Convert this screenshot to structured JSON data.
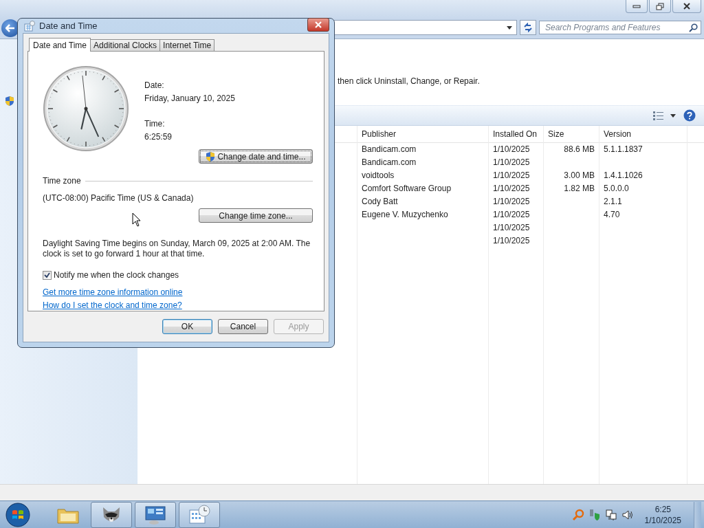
{
  "explorer": {
    "search": {
      "placeholder": "Search Programs and Features"
    },
    "instruction": "then click Uninstall, Change, or Repair.",
    "table": {
      "columns": [
        "Publisher",
        "Installed On",
        "Size",
        "Version"
      ],
      "rows": [
        {
          "publisher": "Bandicam.com",
          "installed_on": "1/10/2025",
          "size": "88.6 MB",
          "version": "5.1.1.1837"
        },
        {
          "publisher": "Bandicam.com",
          "installed_on": "1/10/2025"
        },
        {
          "publisher": "voidtools",
          "installed_on": "1/10/2025",
          "size": "3.00 MB",
          "version": "1.4.1.1026"
        },
        {
          "publisher": "Comfort Software Group",
          "installed_on": "1/10/2025",
          "size": "1.82 MB",
          "version": "5.0.0.0"
        },
        {
          "publisher": "Cody Batt",
          "installed_on": "1/10/2025",
          "version": "2.1.1"
        },
        {
          "publisher": "Eugene V. Muzychenko",
          "installed_on": "1/10/2025",
          "version": "4.70"
        },
        {
          "installed_on": "1/10/2025"
        },
        {
          "installed_on": "1/10/2025"
        }
      ]
    }
  },
  "dialog": {
    "title": "Date and Time",
    "tabs": [
      {
        "label": "Date and Time",
        "selected": true
      },
      {
        "label": "Additional Clocks",
        "selected": false
      },
      {
        "label": "Internet Time",
        "selected": false
      }
    ],
    "date_label": "Date:",
    "date": "Friday, January 10, 2025",
    "time_label": "Time:",
    "time": "6:25:59",
    "change_datetime_button": "Change date and time...",
    "timezone_heading": "Time zone",
    "timezone": "(UTC-08:00) Pacific Time (US & Canada)",
    "change_timezone_button": "Change time zone...",
    "dst_note": "Daylight Saving Time begins on Sunday, March 09, 2025 at 2:00 AM. The clock is set to go forward 1 hour at that time.",
    "notify": {
      "label": "Notify me when the clock changes",
      "checked": true
    },
    "links": [
      "Get more time zone information online",
      "How do I set the clock and time zone?"
    ],
    "buttons": [
      {
        "label": "OK",
        "default": true,
        "disabled": false
      },
      {
        "label": "Cancel",
        "default": false,
        "disabled": false
      },
      {
        "label": "Apply",
        "default": false,
        "disabled": true
      }
    ]
  },
  "taskbar": {
    "clock_time": "6:25",
    "clock_date": "1/10/2025"
  }
}
